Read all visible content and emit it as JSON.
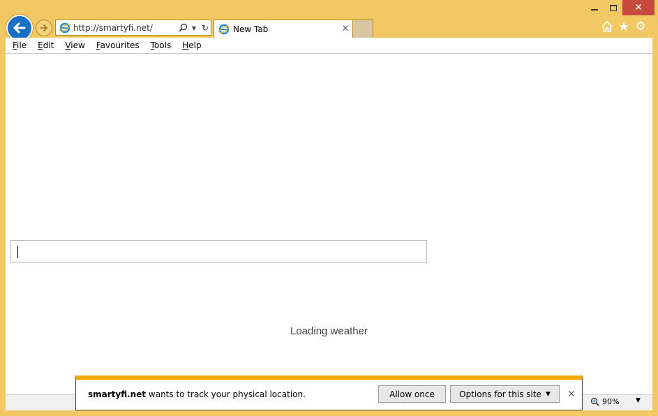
{
  "window": {
    "minimize_glyph": "",
    "close_glyph": "✕"
  },
  "address_bar": {
    "url": "http://smartyfi.net/",
    "search_glyph": "⌕",
    "dropdown_glyph": "▾",
    "refresh_glyph": "↻"
  },
  "tabs": [
    {
      "title": "New Tab",
      "close_glyph": "✕"
    }
  ],
  "toolbar": {
    "star_glyph": "★",
    "gear_glyph": "⚙"
  },
  "menubar": {
    "items": [
      {
        "underline": "F",
        "rest": "ile"
      },
      {
        "underline": "E",
        "rest": "dit"
      },
      {
        "underline": "V",
        "rest": "iew"
      },
      {
        "underline": "F",
        "rest": "avourites"
      },
      {
        "underline": "T",
        "rest": "ools"
      },
      {
        "underline": "H",
        "rest": "elp"
      }
    ]
  },
  "page": {
    "search_value": "",
    "weather_text": "Loading weather"
  },
  "notification": {
    "site": "smartyfi.net",
    "message": " wants to track your physical location.",
    "allow_label": "Allow once",
    "options_label": "Options for this site",
    "close_glyph": "✕"
  },
  "statusbar": {
    "zoom_label": "90%"
  },
  "colors": {
    "frame": "#f1c862",
    "back_button": "#1b6fc4",
    "close_button": "#c74a3c",
    "notification_accent": "#f1a900"
  }
}
